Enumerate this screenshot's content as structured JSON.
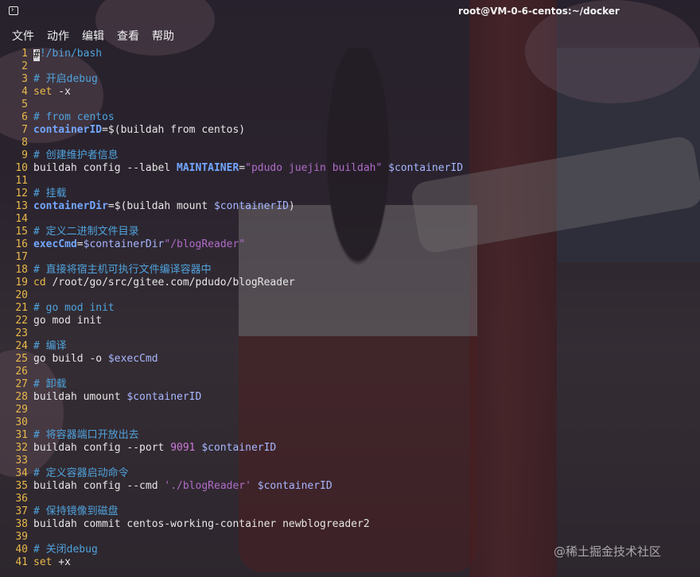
{
  "window": {
    "title": "root@VM-0-6-centos:~/docker"
  },
  "menu": [
    "文件",
    "动作",
    "编辑",
    "查看",
    "帮助"
  ],
  "colors": {
    "comment": "#4fa3dc",
    "line_number": "#e8b94a",
    "variable": "#73a7ff",
    "string": "#b06cc8",
    "number": "#c97ad9"
  },
  "lines": [
    {
      "n": "1",
      "tokens": [
        [
          "cursor",
          "#"
        ],
        [
          "comment",
          "!/bin/bash"
        ]
      ]
    },
    {
      "n": "2",
      "tokens": []
    },
    {
      "n": "3",
      "tokens": [
        [
          "comment",
          "# 开启debug"
        ]
      ]
    },
    {
      "n": "4",
      "tokens": [
        [
          "cmd",
          "set"
        ],
        [
          "plain",
          " -x"
        ]
      ]
    },
    {
      "n": "5",
      "tokens": []
    },
    {
      "n": "6",
      "tokens": [
        [
          "comment",
          "# from centos"
        ]
      ]
    },
    {
      "n": "7",
      "tokens": [
        [
          "var",
          "containerID"
        ],
        [
          "plain",
          "=$(buildah from centos)"
        ]
      ]
    },
    {
      "n": "8",
      "tokens": []
    },
    {
      "n": "9",
      "tokens": [
        [
          "comment",
          "# 创建维护者信息"
        ]
      ]
    },
    {
      "n": "10",
      "tokens": [
        [
          "plain",
          "buildah config --label "
        ],
        [
          "var",
          "MAINTAINER"
        ],
        [
          "plain",
          "="
        ],
        [
          "str",
          "\"pdudo juejin buildah\""
        ],
        [
          "plain",
          " "
        ],
        [
          "ref",
          "$containerID"
        ]
      ]
    },
    {
      "n": "11",
      "tokens": []
    },
    {
      "n": "12",
      "tokens": [
        [
          "comment",
          "# 挂载"
        ]
      ]
    },
    {
      "n": "13",
      "tokens": [
        [
          "var",
          "containerDir"
        ],
        [
          "plain",
          "=$(buildah mount "
        ],
        [
          "ref",
          "$containerID"
        ],
        [
          "plain",
          ")"
        ]
      ]
    },
    {
      "n": "14",
      "tokens": []
    },
    {
      "n": "15",
      "tokens": [
        [
          "comment",
          "# 定义二进制文件目录"
        ]
      ]
    },
    {
      "n": "16",
      "tokens": [
        [
          "var",
          "execCmd"
        ],
        [
          "plain",
          "="
        ],
        [
          "ref",
          "$containerDir"
        ],
        [
          "str",
          "\"/blogReader\""
        ]
      ]
    },
    {
      "n": "17",
      "tokens": []
    },
    {
      "n": "18",
      "tokens": [
        [
          "comment",
          "# 直接将宿主机可执行文件编译容器中"
        ]
      ]
    },
    {
      "n": "19",
      "tokens": [
        [
          "cmd",
          "cd"
        ],
        [
          "plain",
          " /root/go/src/gitee.com/pdudo/blogReader"
        ]
      ]
    },
    {
      "n": "20",
      "tokens": []
    },
    {
      "n": "21",
      "tokens": [
        [
          "comment",
          "# go mod init"
        ]
      ]
    },
    {
      "n": "22",
      "tokens": [
        [
          "plain",
          "go mod init"
        ]
      ]
    },
    {
      "n": "23",
      "tokens": []
    },
    {
      "n": "24",
      "tokens": [
        [
          "comment",
          "# 编译"
        ]
      ]
    },
    {
      "n": "25",
      "tokens": [
        [
          "plain",
          "go build -o "
        ],
        [
          "ref",
          "$execCmd"
        ]
      ]
    },
    {
      "n": "26",
      "tokens": []
    },
    {
      "n": "27",
      "tokens": [
        [
          "comment",
          "# 卸载"
        ]
      ]
    },
    {
      "n": "28",
      "tokens": [
        [
          "plain",
          "buildah umount "
        ],
        [
          "ref",
          "$containerID"
        ]
      ]
    },
    {
      "n": "29",
      "tokens": []
    },
    {
      "n": "30",
      "tokens": []
    },
    {
      "n": "31",
      "tokens": [
        [
          "comment",
          "# 将容器端口开放出去"
        ]
      ]
    },
    {
      "n": "32",
      "tokens": [
        [
          "plain",
          "buildah config --port "
        ],
        [
          "num",
          "9091"
        ],
        [
          "plain",
          " "
        ],
        [
          "ref",
          "$containerID"
        ]
      ]
    },
    {
      "n": "33",
      "tokens": []
    },
    {
      "n": "34",
      "tokens": [
        [
          "comment",
          "# 定义容器启动命令"
        ]
      ]
    },
    {
      "n": "35",
      "tokens": [
        [
          "plain",
          "buildah config --cmd "
        ],
        [
          "str",
          "'./blogReader'"
        ],
        [
          "plain",
          " "
        ],
        [
          "ref",
          "$containerID"
        ]
      ]
    },
    {
      "n": "36",
      "tokens": []
    },
    {
      "n": "37",
      "tokens": [
        [
          "comment",
          "# 保持镜像到磁盘"
        ]
      ]
    },
    {
      "n": "38",
      "tokens": [
        [
          "plain",
          "buildah commit centos-working-container newblogreader2"
        ]
      ]
    },
    {
      "n": "39",
      "tokens": []
    },
    {
      "n": "40",
      "tokens": [
        [
          "comment",
          "# 关闭debug"
        ]
      ]
    },
    {
      "n": "41",
      "tokens": [
        [
          "cmd",
          "set"
        ],
        [
          "plain",
          " +x"
        ]
      ]
    }
  ],
  "watermark": "@稀土掘金技术社区"
}
